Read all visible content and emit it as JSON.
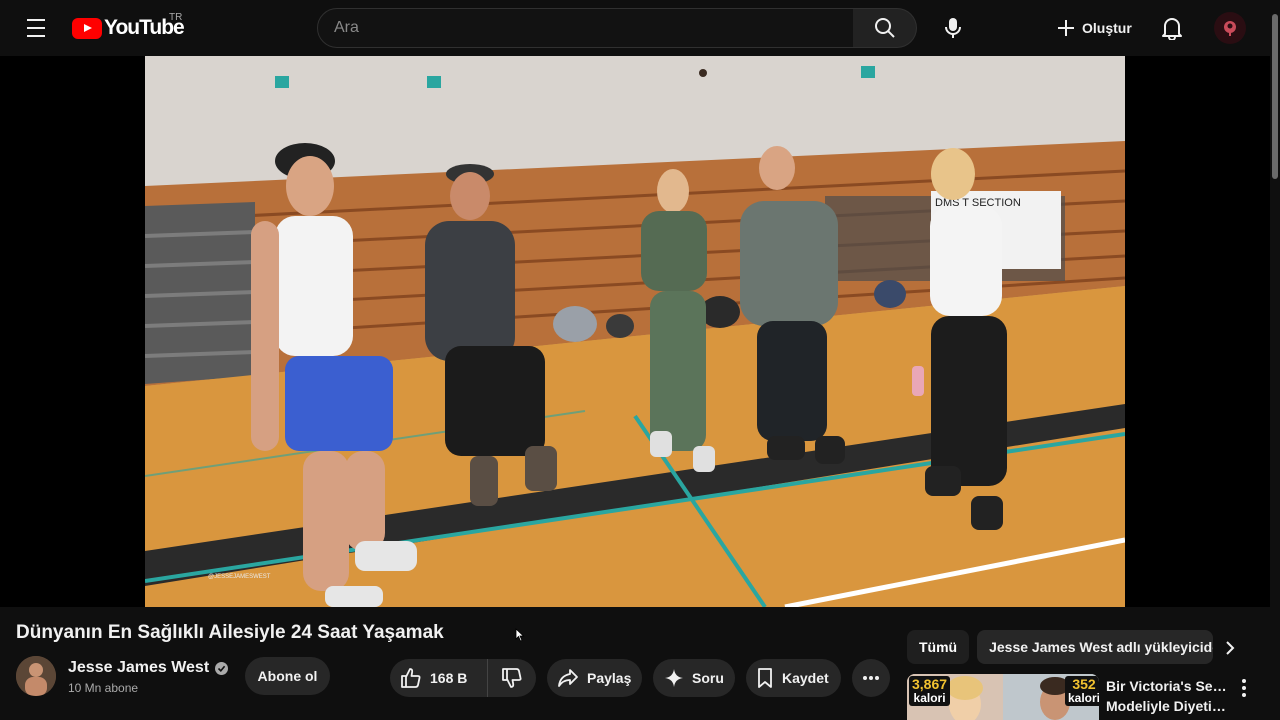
{
  "header": {
    "logo_text": "YouTube",
    "region": "TR",
    "search_placeholder": "Ara",
    "create_label": "Oluştur"
  },
  "video": {
    "title": "Dünyanın En Sağlıklı Ailesiyle 24 Saat Yaşamak",
    "banner_text": "DMS   T SECTION",
    "watermark": "@JESSEJAMESWEST"
  },
  "channel": {
    "name": "Jesse James West",
    "subscribers": "10 Mn abone",
    "subscribe_label": "Abone ol"
  },
  "actions": {
    "likes": "168 B",
    "share_label": "Paylaş",
    "ask_label": "Soru",
    "save_label": "Kaydet"
  },
  "chips": {
    "all": "Tümü",
    "uploader": "Jesse James West adlı yükleyiciden"
  },
  "recommendation": {
    "title_line1": "Bir Victoria's Secret",
    "title_line2": "Modeliyle Diyetim...",
    "badge_left_value": "3,867",
    "badge_left_unit": "kalori",
    "badge_right_value": "352",
    "badge_right_unit": "kalori"
  },
  "colors": {
    "background": "#0f0f0f",
    "brand_red": "#ff0000",
    "pill": "#272727"
  }
}
